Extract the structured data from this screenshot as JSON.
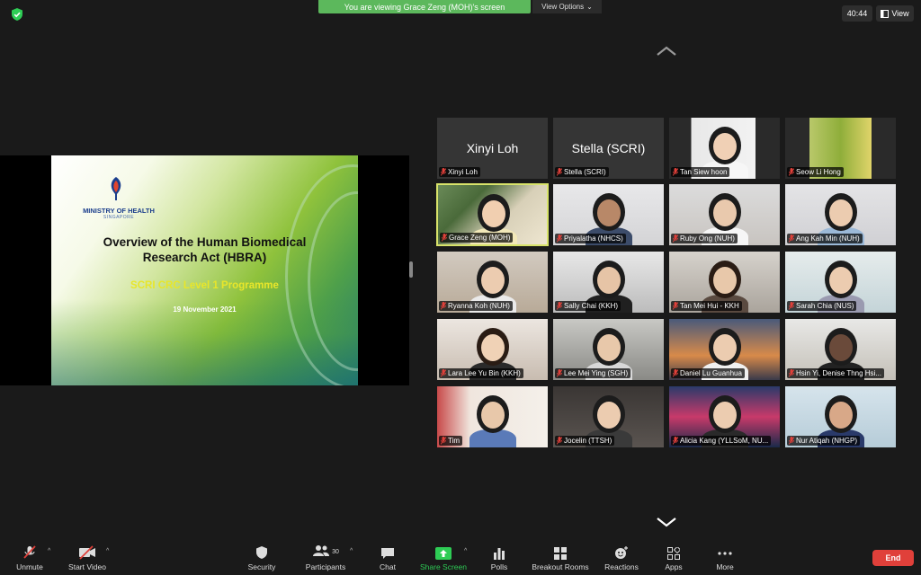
{
  "banner": {
    "text": "You are viewing Grace Zeng (MOH)'s screen",
    "view_options": "View Options"
  },
  "timer": "40:44",
  "view_label": "View",
  "slide": {
    "org_name": "MINISTRY OF HEALTH",
    "org_sub": "SINGAPORE",
    "title": "Overview of the Human Biomedical Research Act (HBRA)",
    "programme": "SCRI CRC Level 1 Programme",
    "date": "19 November 2021"
  },
  "participants": [
    {
      "name": "Xinyi Loh",
      "big": "Xinyi Loh"
    },
    {
      "name": "Stella (SCRI)",
      "big": "Stella (SCRI)"
    },
    {
      "name": "Tan Siew hoon",
      "big": ""
    },
    {
      "name": "Seow Li Hong",
      "big": ""
    },
    {
      "name": "Grace Zeng (MOH)",
      "big": ""
    },
    {
      "name": "Priyalatha (NHCS)",
      "big": ""
    },
    {
      "name": "Ruby Ong (NUH)",
      "big": ""
    },
    {
      "name": "Ang Kah Min (NUH)",
      "big": ""
    },
    {
      "name": "Ryanna Koh (NUH)",
      "big": ""
    },
    {
      "name": "Sally Chai (KKH)",
      "big": ""
    },
    {
      "name": "Tan Mei Hui - KKH",
      "big": ""
    },
    {
      "name": "Sarah Chia (NUS)",
      "big": ""
    },
    {
      "name": "Lara Lee Yu Bin (KKH)",
      "big": ""
    },
    {
      "name": "Lee Mei Ying (SGH)",
      "big": ""
    },
    {
      "name": "Daniel Lu Guanhua",
      "big": ""
    },
    {
      "name": "Hsin Yi, Denise Thng Hsi...",
      "big": ""
    },
    {
      "name": "Tim",
      "big": ""
    },
    {
      "name": "Jocelin (TTSH)",
      "big": ""
    },
    {
      "name": "Alicia Kang (YLLSoM, NU...",
      "big": ""
    },
    {
      "name": "Nur Atiqah (NHGP)",
      "big": ""
    }
  ],
  "toolbar": {
    "unmute": "Unmute",
    "start_video": "Start Video",
    "security": "Security",
    "participants": "Participants",
    "participant_count": "30",
    "chat": "Chat",
    "share_screen": "Share Screen",
    "polls": "Polls",
    "breakout_rooms": "Breakout Rooms",
    "reactions": "Reactions",
    "apps": "Apps",
    "more": "More",
    "end": "End"
  },
  "colors": {
    "share_green": "#5cb85c",
    "end_red": "#e0403a",
    "active_border": "#d8e36a",
    "programme_yellow": "#e8e62a"
  }
}
